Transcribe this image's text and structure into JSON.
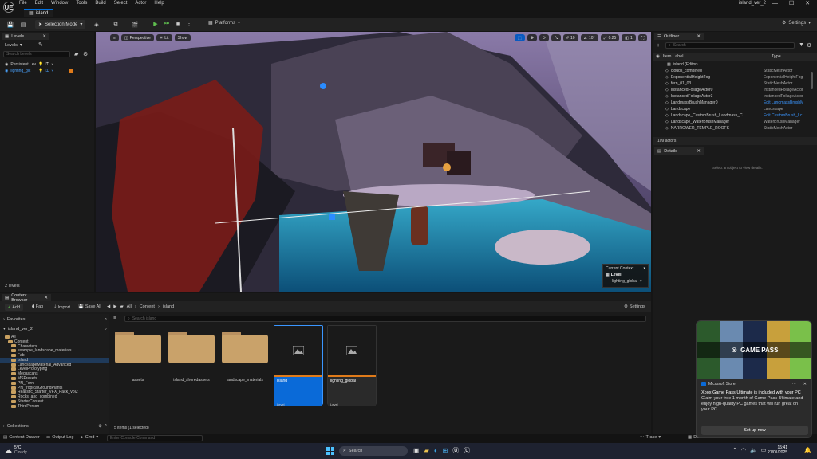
{
  "titlebar": {
    "logo": "UE",
    "menu": [
      "File",
      "Edit",
      "Window",
      "Tools",
      "Build",
      "Select",
      "Actor",
      "Help"
    ],
    "project": "island_ver_2",
    "level_tab": "island"
  },
  "toolbar": {
    "mode": "Selection Mode",
    "platforms": "Platforms",
    "settings": "Settings"
  },
  "levels": {
    "tab": "Levels",
    "dropdown": "Levels",
    "search_placeholder": "Search Levels",
    "rows": [
      "Persistent Lev",
      "lighting_glc"
    ],
    "count": "2 levels"
  },
  "viewport": {
    "buttons": [
      "Perspective",
      "Lit",
      "Show"
    ],
    "right_values": [
      "10",
      "10°",
      "0.25",
      "1"
    ],
    "context_title": "Current Context",
    "context_level": "Level",
    "context_value": "lighting_global"
  },
  "outliner": {
    "tab": "Outliner",
    "search_placeholder": "Search",
    "col_label": "Item Label",
    "col_type": "Type",
    "rows": [
      {
        "name": "island (Editor)",
        "type": ""
      },
      {
        "name": "clouds_combined",
        "type": "StaticMeshActor"
      },
      {
        "name": "ExponentialHeightFog",
        "type": "ExponentialHeightFog"
      },
      {
        "name": "fern_01_03",
        "type": "StaticMeshActor"
      },
      {
        "name": "InstancedFoliageActor0",
        "type": "InstancedFoliageActor"
      },
      {
        "name": "InstancedFoliageActor3",
        "type": "InstancedFoliageActor"
      },
      {
        "name": "LandmassBrushManager0",
        "type": "Edit LandmassBrushM"
      },
      {
        "name": "Landscape",
        "type": "Landscape"
      },
      {
        "name": "Landscape_CustomBrush_Landmass_C",
        "type": "Edit CustomBrush_Lc"
      },
      {
        "name": "Landscape_WaterBrushManager",
        "type": "WaterBrushManager"
      },
      {
        "name": "NARROWER_TEMPLE_ROOFS",
        "type": "StaticMeshActor"
      }
    ],
    "count": "109 actors"
  },
  "details": {
    "tab": "Details",
    "empty": "Select an object to view details."
  },
  "content_browser": {
    "tab": "Content Browser",
    "add": "Add",
    "fab": "Fab",
    "import": "Import",
    "save_all": "Save All",
    "breadcrumb": [
      "All",
      "Content",
      "island"
    ],
    "settings": "Settings",
    "favorites": "Favorites",
    "project": "island_ver_2",
    "search_placeholder": "Search island",
    "tree": [
      "All",
      "Content",
      "Characters",
      "example_landscape_materials",
      "Fab",
      "island",
      "LandscapeMaterial_Advanced",
      "LevelPrototyping",
      "Megascans",
      "MSPresets",
      "PN_Fern",
      "PN_tropicalGroundPlants",
      "Realistic_Starter_VFX_Pack_Vol2",
      "Rocks_and_combined",
      "StarterContent",
      "ThirdPerson"
    ],
    "assets": [
      {
        "name": "assets",
        "kind": "folder"
      },
      {
        "name": "island_shoredassets",
        "kind": "folder"
      },
      {
        "name": "landscape_materials",
        "kind": "folder"
      },
      {
        "name": "island",
        "kind": "level",
        "sub": "Level"
      },
      {
        "name": "lighting_global",
        "kind": "level",
        "sub": "Level"
      }
    ],
    "status": "5 items (1 selected)",
    "collections": "Collections"
  },
  "statusbar": {
    "drawer": "Content Drawer",
    "output": "Output Log",
    "cmd": "Cmd",
    "console_placeholder": "Enter Console Command",
    "trace": "Trace",
    "derived": "Derived Data",
    "all_saved": "All Saved",
    "revision": "Revision Control"
  },
  "notification": {
    "banner": "GAME PASS",
    "source": "Microsoft Store",
    "title": "Xbox Game Pass Ultimate is included with your PC",
    "body": "Claim your free 1 month of Game Pass Ultimate and enjoy high-quality PC games that will run great on your PC",
    "button": "Set up now"
  },
  "taskbar": {
    "temp": "5°C",
    "weather": "Cloudy",
    "search": "Search",
    "time": "15:41",
    "date": "21/01/2025"
  }
}
